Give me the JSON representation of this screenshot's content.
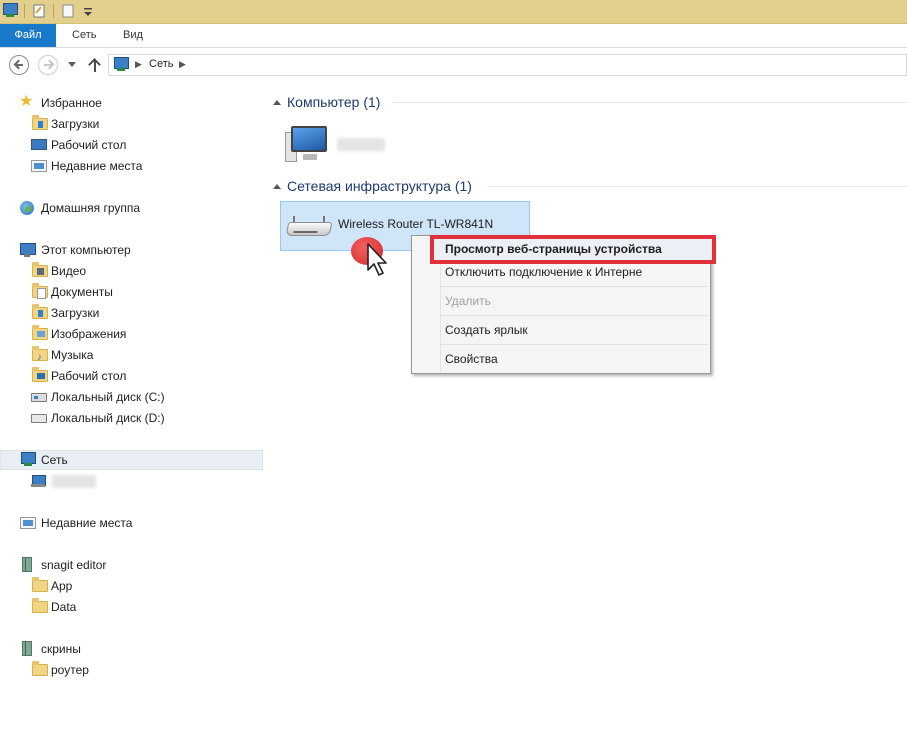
{
  "ribbon": {
    "tabs": [
      "Файл",
      "Сеть",
      "Вид"
    ]
  },
  "address": {
    "crumbs": [
      "Сеть"
    ]
  },
  "sidebar": {
    "favorites": {
      "label": "Избранное",
      "items": [
        "Загрузки",
        "Рабочий стол",
        "Недавние места"
      ]
    },
    "homegroup": "Домашняя группа",
    "this_pc": {
      "label": "Этот компьютер",
      "items": [
        "Видео",
        "Документы",
        "Загрузки",
        "Изображения",
        "Музыка",
        "Рабочий стол",
        "Локальный диск (C:)",
        "Локальный диск (D:)"
      ]
    },
    "network": {
      "label": "Сеть"
    },
    "recent_places": "Недавние места",
    "snagit": {
      "label": "snagit editor",
      "items": [
        "App",
        "Data"
      ]
    },
    "screens": {
      "label": "скрины",
      "items": [
        "роутер"
      ]
    }
  },
  "content": {
    "groups": [
      {
        "title": "Компьютер (1)"
      },
      {
        "title": "Сетевая инфраструктура (1)",
        "device": "Wireless Router TL-WR841N"
      }
    ]
  },
  "context_menu": {
    "items": [
      {
        "label": "Просмотр веб-страницы устройства",
        "bold": true,
        "enabled": true
      },
      {
        "label": "Отключить подключение к Интерне",
        "enabled": true
      },
      {
        "label": "Удалить",
        "enabled": false
      },
      {
        "label": "Создать ярлык",
        "enabled": true
      },
      {
        "label": "Свойства",
        "enabled": true
      }
    ]
  },
  "colors": {
    "titlebar": "#e3cf8c",
    "file_tab": "#1979ca",
    "selection": "#cfe5f8",
    "highlight_frame": "#e0313b",
    "group_header": "#1e3a6e"
  }
}
